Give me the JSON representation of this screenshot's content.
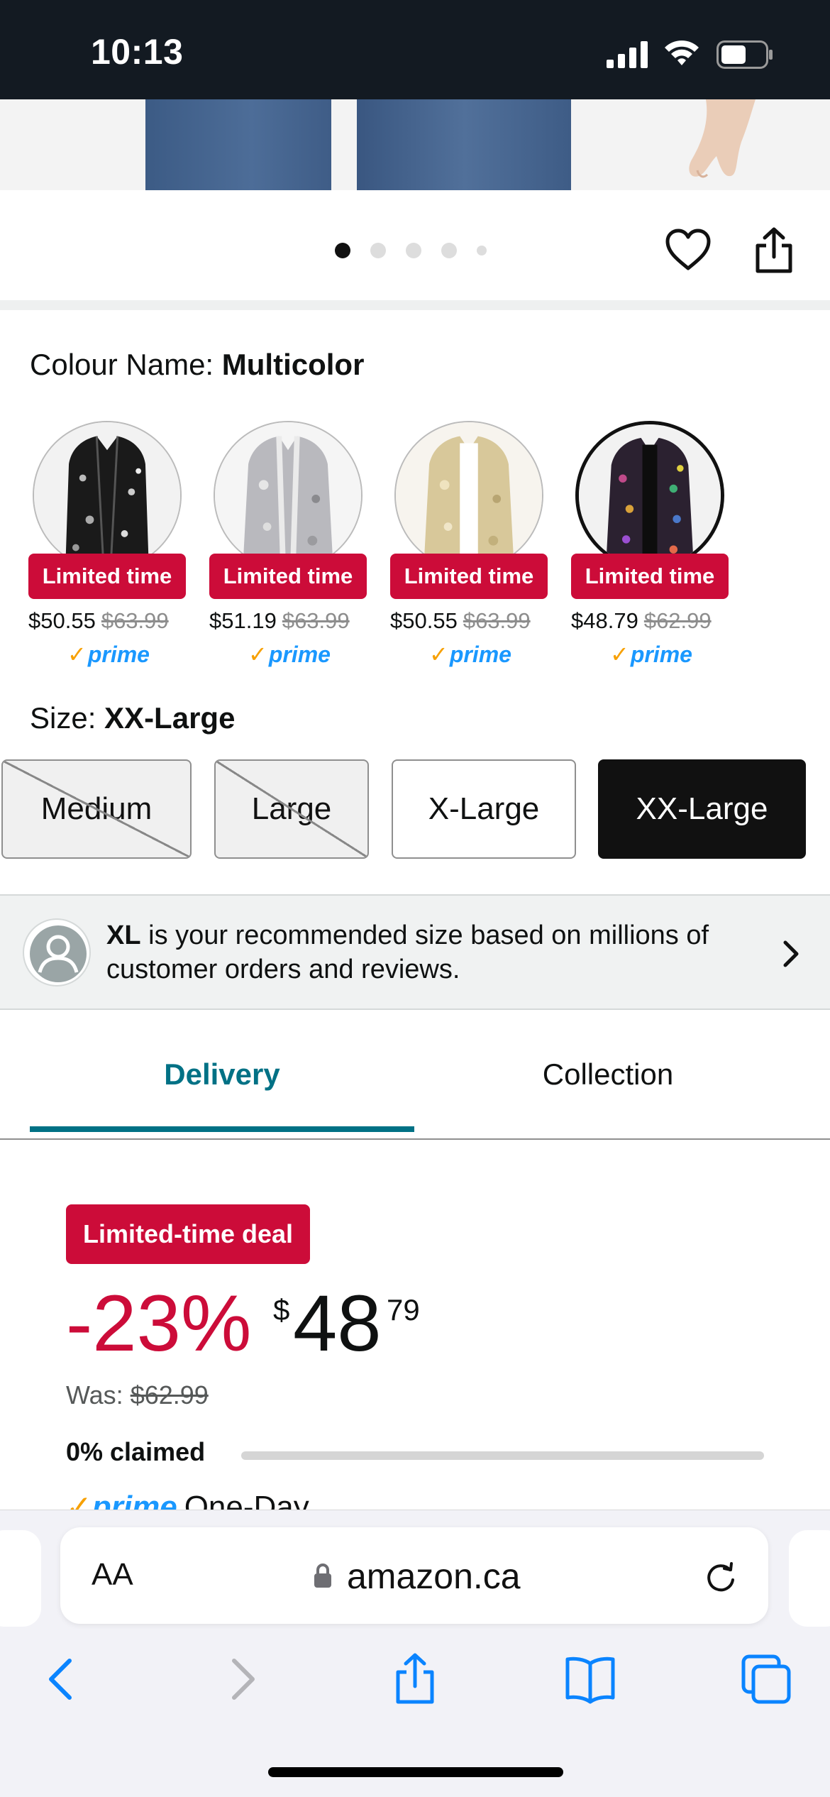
{
  "status_bar": {
    "time": "10:13"
  },
  "carousel": {
    "dot_count": 5,
    "active_index": 0
  },
  "colour": {
    "label": "Colour Name:",
    "selected": "Multicolor",
    "swatches": [
      {
        "badge": "Limited time",
        "price": "$50.55",
        "was": "$63.99",
        "prime": "prime"
      },
      {
        "badge": "Limited time",
        "price": "$51.19",
        "was": "$63.99",
        "prime": "prime"
      },
      {
        "badge": "Limited time",
        "price": "$50.55",
        "was": "$63.99",
        "prime": "prime"
      },
      {
        "badge": "Limited time",
        "price": "$48.79",
        "was": "$62.99",
        "prime": "prime"
      }
    ]
  },
  "size": {
    "label": "Size:",
    "selected": "XX-Large",
    "options": [
      "Medium",
      "Large",
      "X-Large",
      "XX-Large"
    ]
  },
  "recommendation": {
    "size": "XL",
    "text": " is your recommended size based on millions of customer orders and reviews."
  },
  "tabs": {
    "delivery": "Delivery",
    "collection": "Collection"
  },
  "deal": {
    "badge": "Limited-time deal",
    "discount": "-23%",
    "currency": "$",
    "price_whole": "48",
    "price_fraction": "79",
    "was_label": "Was:",
    "was_price": "$62.99",
    "claimed": "0% claimed",
    "claimed_fraction": 0,
    "prime_word": "prime",
    "shipping": "One-Day"
  },
  "browser": {
    "text_size": "AA",
    "domain": "amazon.ca"
  },
  "colors": {
    "deal_red": "#cc0c39",
    "teal": "#007185",
    "prime_blue": "#1a98ff",
    "ios_blue": "#0a84ff"
  }
}
